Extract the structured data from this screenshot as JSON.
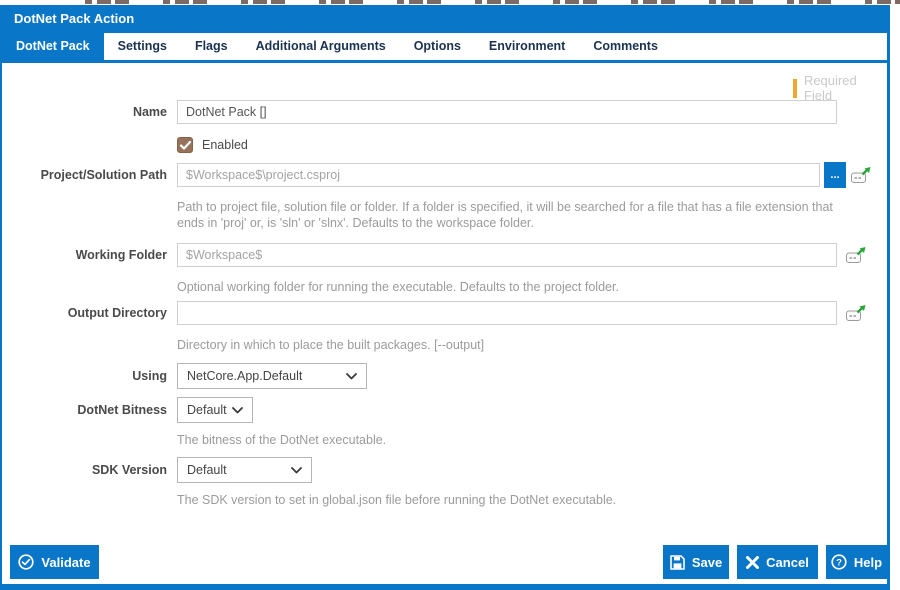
{
  "dialog": {
    "title": "DotNet Pack Action"
  },
  "tabs": [
    {
      "label": "DotNet Pack",
      "active": true
    },
    {
      "label": "Settings",
      "active": false
    },
    {
      "label": "Flags",
      "active": false
    },
    {
      "label": "Additional Arguments",
      "active": false
    },
    {
      "label": "Options",
      "active": false
    },
    {
      "label": "Environment",
      "active": false
    },
    {
      "label": "Comments",
      "active": false
    }
  ],
  "required_flag": {
    "label": "Required Field"
  },
  "fields": {
    "name": {
      "label": "Name",
      "value": "DotNet Pack []"
    },
    "enabled": {
      "label": "Enabled",
      "checked": true
    },
    "project_path": {
      "label": "Project/Solution Path",
      "placeholder": "$Workspace$\\project.csproj",
      "browse_label": "...",
      "help_line1": "Path to project file, solution file or folder. If a folder is specified, it will be searched for a file that has a file extension that",
      "help_line2": "ends in 'proj' or, is 'sln' or 'slnx'. Defaults to the workspace folder."
    },
    "working_folder": {
      "label": "Working Folder",
      "placeholder": "$Workspace$",
      "help": "Optional working folder for running the executable. Defaults to the project folder."
    },
    "output_directory": {
      "label": "Output Directory",
      "value": "",
      "help": "Directory in which to place the built packages. [--output]"
    },
    "using": {
      "label": "Using",
      "value": "NetCore.App.Default"
    },
    "bitness": {
      "label": "DotNet Bitness",
      "value": "Default",
      "help": "The bitness of the DotNet executable."
    },
    "sdk_version": {
      "label": "SDK Version",
      "value": "Default",
      "help": "The SDK version to set in global.json file before running the DotNet executable."
    }
  },
  "buttons": {
    "validate": "Validate",
    "save": "Save",
    "cancel": "Cancel",
    "help": "Help"
  },
  "colors": {
    "accent_blue": "#0a76c8",
    "required_marker_orange": "#f2a52e",
    "checkbox_brown": "#96735a"
  }
}
